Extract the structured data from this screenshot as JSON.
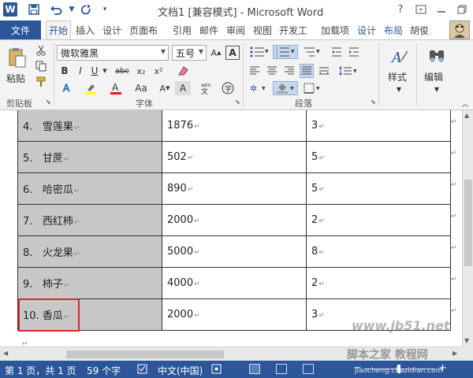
{
  "title_bar": {
    "title": "文档1 [兼容模式] - Microsoft Word",
    "logo_letter": "W",
    "icons": [
      "word-logo",
      "save-icon",
      "undo-icon",
      "redo-icon",
      "help-icon",
      "ribbon-display-icon",
      "minimize-icon",
      "restore-icon"
    ],
    "help_symbol": "?"
  },
  "tabs": {
    "file": "文件",
    "items": [
      "开始",
      "插入",
      "设计",
      "页面布",
      "引用",
      "邮件",
      "审阅",
      "视图",
      "开发工",
      "加载项",
      "设计",
      "布局"
    ],
    "active_index": 0,
    "user": "胡俊"
  },
  "ribbon": {
    "clipboard": {
      "paste": "粘贴",
      "label": "剪贴板"
    },
    "font": {
      "font_name": "微软雅黑",
      "font_size": "五号",
      "char_border": "A",
      "bold": "B",
      "italic": "I",
      "underline": "U",
      "strikethrough": "abc",
      "subscript": "x₂",
      "superscript": "x²",
      "change_case": "Aa",
      "text_effect": "A",
      "label": "字体"
    },
    "paragraph": {
      "label": "段落"
    },
    "styles": {
      "label": "样式"
    },
    "editing": {
      "label": "编辑"
    }
  },
  "table": {
    "rows": [
      {
        "num": "4.",
        "name": "雪莲果",
        "value": "1876",
        "count": "3"
      },
      {
        "num": "5.",
        "name": "甘蔗",
        "value": "502",
        "count": "5"
      },
      {
        "num": "6.",
        "name": "哈密瓜",
        "value": "890",
        "count": "5"
      },
      {
        "num": "7.",
        "name": "西红柿",
        "value": "2000",
        "count": "2"
      },
      {
        "num": "8.",
        "name": "火龙果",
        "value": "5000",
        "count": "8"
      },
      {
        "num": "9.",
        "name": "柿子",
        "value": "4000",
        "count": "2"
      },
      {
        "num": "10.",
        "name": "香瓜",
        "value": "2000",
        "count": "3"
      }
    ],
    "paragraph_mark": "↵",
    "highlighted_row_index": 6
  },
  "status_bar": {
    "page": "第 1 页，共 1 页",
    "word_count": "59 个字",
    "language": "中文(中国)"
  },
  "watermark": {
    "text": "脚本之家 教程网",
    "url": "jiaocheng.chazidian.com",
    "site": "www.jb51.net"
  },
  "colors": {
    "accent": "#2b579a",
    "highlight_border": "#d9262c",
    "selection_gray": "#c8c8c8"
  }
}
